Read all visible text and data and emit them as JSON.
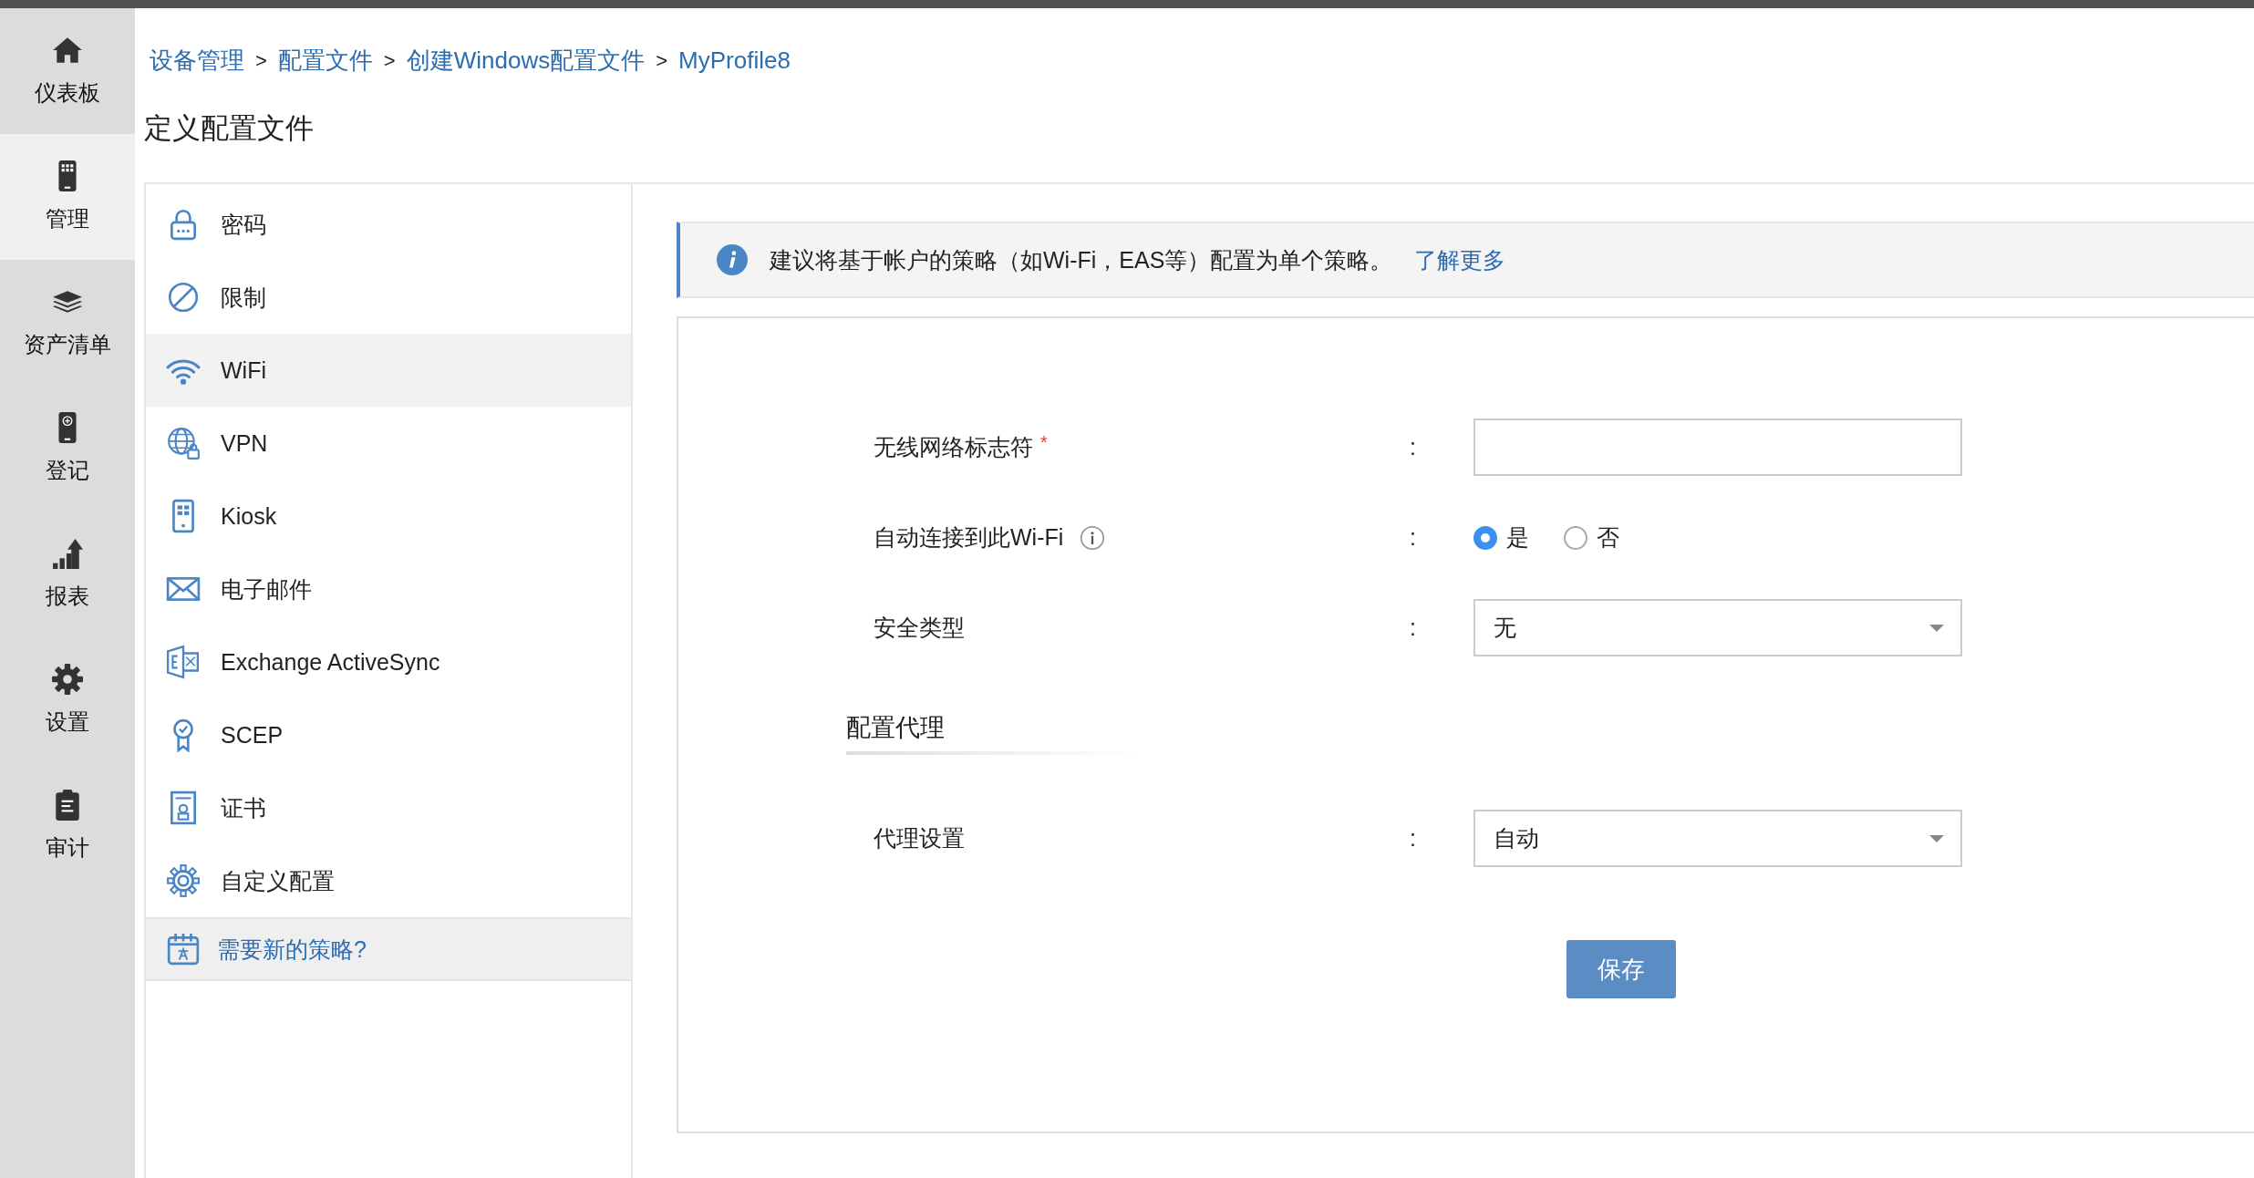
{
  "nav": [
    {
      "label": "仪表板",
      "selected": false
    },
    {
      "label": "管理",
      "selected": true
    },
    {
      "label": "资产清单",
      "selected": false
    },
    {
      "label": "登记",
      "selected": false
    },
    {
      "label": "报表",
      "selected": false
    },
    {
      "label": "设置",
      "selected": false
    },
    {
      "label": "审计",
      "selected": false
    }
  ],
  "breadcrumb": [
    {
      "kind": "link",
      "text": "设备管理"
    },
    {
      "kind": "separator",
      "text": ">"
    },
    {
      "kind": "link",
      "text": "配置文件"
    },
    {
      "kind": "separator",
      "text": ">"
    },
    {
      "kind": "link",
      "text": "创建Windows配置文件"
    },
    {
      "kind": "separator",
      "text": ">"
    },
    {
      "kind": "link",
      "text": "MyProfile8"
    }
  ],
  "page_title": "定义配置文件",
  "policy_menu": [
    {
      "label": "密码",
      "selected": false
    },
    {
      "label": "限制",
      "selected": false
    },
    {
      "label": "WiFi",
      "selected": true
    },
    {
      "label": "VPN",
      "selected": false
    },
    {
      "label": "Kiosk",
      "selected": false
    },
    {
      "label": "电子邮件",
      "selected": false
    },
    {
      "label": "Exchange ActiveSync",
      "selected": false
    },
    {
      "label": "SCEP",
      "selected": false
    },
    {
      "label": "证书",
      "selected": false
    },
    {
      "label": "自定义配置",
      "selected": false
    }
  ],
  "new_policy_link": "需要新的策略?",
  "banner": {
    "text": "建议将基于帐户的策略（如Wi-Fi，EAS等）配置为单个策略。",
    "link": "了解更多"
  },
  "fields": [
    {
      "kind": "text",
      "label": "无线网络标志符",
      "required_mark": "*",
      "info": false,
      "colon": ":"
    },
    {
      "kind": "radio",
      "label": "自动连接到此Wi-Fi",
      "info": true,
      "colon": ":",
      "options": [
        {
          "label": "是",
          "selected": true
        },
        {
          "label": "否",
          "selected": false
        }
      ]
    },
    {
      "kind": "select",
      "label": "安全类型",
      "info": false,
      "colon": ":",
      "value": "无"
    }
  ],
  "proxy_section": {
    "title": "配置代理",
    "fields": [
      {
        "kind": "select",
        "label": "代理设置",
        "info": false,
        "colon": ":",
        "value": "自动"
      }
    ]
  },
  "save_button": "保存"
}
